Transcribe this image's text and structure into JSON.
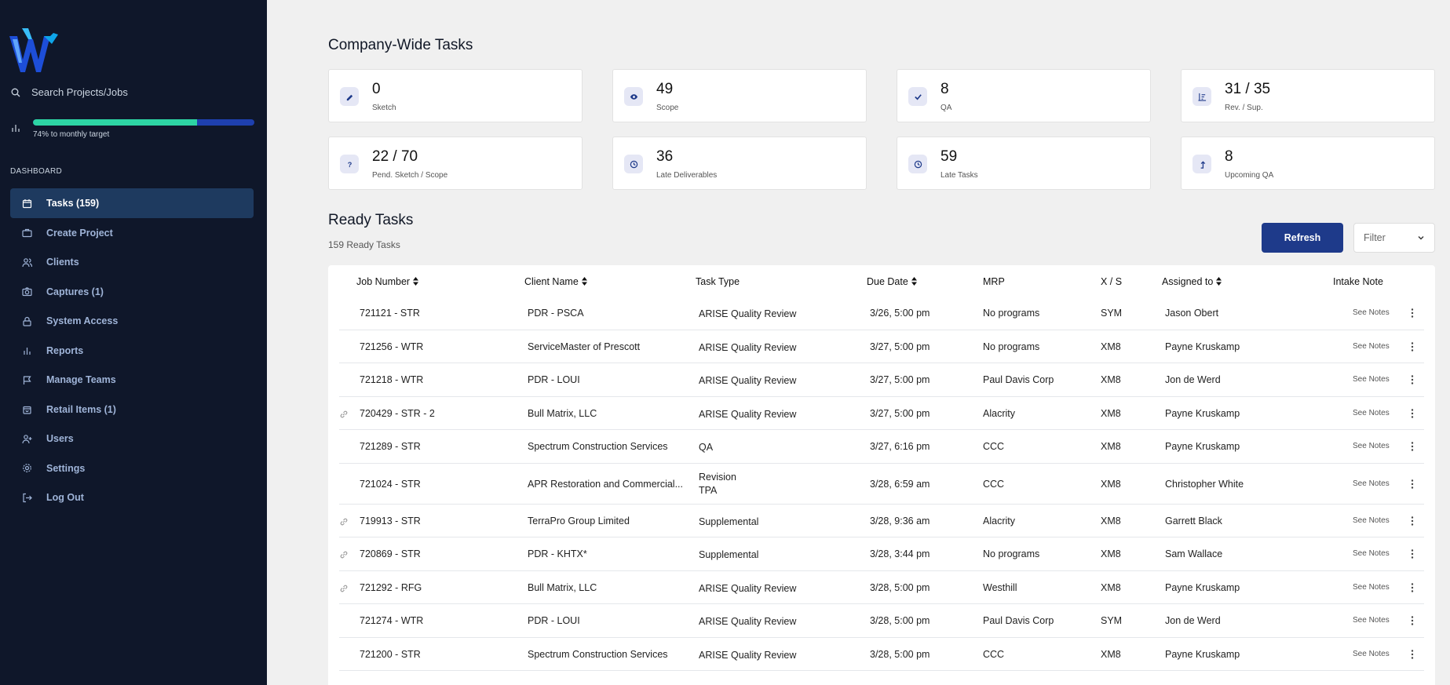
{
  "sidebar": {
    "search_label": "Search Projects/Jobs",
    "progress": {
      "fraction": 0.74,
      "label": "74% to monthly target"
    },
    "section_label": "DASHBOARD",
    "items": [
      {
        "label": "Tasks (159)",
        "icon": "calendar-icon",
        "active": true
      },
      {
        "label": "Create Project",
        "icon": "briefcase-icon"
      },
      {
        "label": "Clients",
        "icon": "users-icon"
      },
      {
        "label": "Captures (1)",
        "icon": "camera-icon"
      },
      {
        "label": "System Access",
        "icon": "lock-icon"
      },
      {
        "label": "Reports",
        "icon": "bar-chart-icon"
      },
      {
        "label": "Manage Teams",
        "icon": "flag-icon"
      },
      {
        "label": "Retail Items (1)",
        "icon": "shopping-bag-icon"
      },
      {
        "label": "Users",
        "icon": "user-plus-icon"
      },
      {
        "label": "Settings",
        "icon": "gear-icon"
      },
      {
        "label": "Log Out",
        "icon": "logout-icon"
      }
    ]
  },
  "main": {
    "title": "Company-Wide Tasks",
    "cards": [
      {
        "value": "0",
        "label": "Sketch",
        "icon": "pencil-icon"
      },
      {
        "value": "49",
        "label": "Scope",
        "icon": "eye-icon"
      },
      {
        "value": "8",
        "label": "QA",
        "icon": "check-icon"
      },
      {
        "value": "31 / 35",
        "label": "Rev. / Sup.",
        "icon": "sort-icon"
      },
      {
        "value": "22 / 70",
        "label": "Pend. Sketch / Scope",
        "icon": "question-icon"
      },
      {
        "value": "36",
        "label": "Late Deliverables",
        "icon": "clock-icon"
      },
      {
        "value": "59",
        "label": "Late Tasks",
        "icon": "clock-icon"
      },
      {
        "value": "8",
        "label": "Upcoming QA",
        "icon": "arrow-up-icon"
      }
    ],
    "ready_title": "Ready Tasks",
    "ready_count": "159 Ready Tasks",
    "refresh_label": "Refresh",
    "filter_placeholder": "Filter",
    "table": {
      "columns": [
        "Job Number",
        "Client Name",
        "Task Type",
        "Due Date",
        "MRP",
        "X / S",
        "Assigned to",
        "Intake Note"
      ],
      "notes_label": "See Notes",
      "rows": [
        {
          "linked": false,
          "job": "721121 - STR",
          "client": "PDR - PSCA",
          "task": [
            "ARISE Quality Review"
          ],
          "due": "3/26, 5:00 pm",
          "mrp": "No programs",
          "xs": "SYM",
          "assigned": "Jason Obert"
        },
        {
          "linked": false,
          "job": "721256 - WTR",
          "client": "ServiceMaster of Prescott",
          "task": [
            "ARISE Quality Review"
          ],
          "due": "3/27, 5:00 pm",
          "mrp": "No programs",
          "xs": "XM8",
          "assigned": "Payne Kruskamp"
        },
        {
          "linked": false,
          "job": "721218 - WTR",
          "client": "PDR - LOUI",
          "task": [
            "ARISE Quality Review"
          ],
          "due": "3/27, 5:00 pm",
          "mrp": "Paul Davis Corp",
          "xs": "XM8",
          "assigned": "Jon de Werd"
        },
        {
          "linked": true,
          "job": "720429 - STR - 2",
          "client": "Bull Matrix, LLC",
          "task": [
            "ARISE Quality Review"
          ],
          "due": "3/27, 5:00 pm",
          "mrp": "Alacrity",
          "xs": "XM8",
          "assigned": "Payne Kruskamp"
        },
        {
          "linked": false,
          "job": "721289 - STR",
          "client": "Spectrum Construction Services",
          "task": [
            "QA"
          ],
          "due": "3/27, 6:16 pm",
          "mrp": "CCC",
          "xs": "XM8",
          "assigned": "Payne Kruskamp"
        },
        {
          "linked": false,
          "job": "721024 - STR",
          "client": "APR Restoration and Commercial...",
          "task": [
            "Revision",
            "TPA"
          ],
          "due": "3/28, 6:59 am",
          "mrp": "CCC",
          "xs": "XM8",
          "assigned": "Christopher White"
        },
        {
          "linked": true,
          "job": "719913 - STR",
          "client": "TerraPro Group Limited",
          "task": [
            "Supplemental"
          ],
          "due": "3/28, 9:36 am",
          "mrp": "Alacrity",
          "xs": "XM8",
          "assigned": "Garrett Black"
        },
        {
          "linked": true,
          "job": "720869 - STR",
          "client": "PDR - KHTX*",
          "task": [
            "Supplemental"
          ],
          "due": "3/28, 3:44 pm",
          "mrp": "No programs",
          "xs": "XM8",
          "assigned": "Sam Wallace"
        },
        {
          "linked": true,
          "job": "721292 - RFG",
          "client": "Bull Matrix, LLC",
          "task": [
            "ARISE Quality Review"
          ],
          "due": "3/28, 5:00 pm",
          "mrp": "Westhill",
          "xs": "XM8",
          "assigned": "Payne Kruskamp"
        },
        {
          "linked": false,
          "job": "721274 - WTR",
          "client": "PDR - LOUI",
          "task": [
            "ARISE Quality Review"
          ],
          "due": "3/28, 5:00 pm",
          "mrp": "Paul Davis Corp",
          "xs": "SYM",
          "assigned": "Jon de Werd"
        },
        {
          "linked": false,
          "job": "721200 - STR",
          "client": "Spectrum Construction Services",
          "task": [
            "ARISE Quality Review"
          ],
          "due": "3/28, 5:00 pm",
          "mrp": "CCC",
          "xs": "XM8",
          "assigned": "Payne Kruskamp"
        }
      ]
    }
  },
  "colors": {
    "sidebar_bg": "#0f172a",
    "accent": "#1e3a8a",
    "progress_fill": "#2dd4a4",
    "progress_track": "#1e40af"
  }
}
